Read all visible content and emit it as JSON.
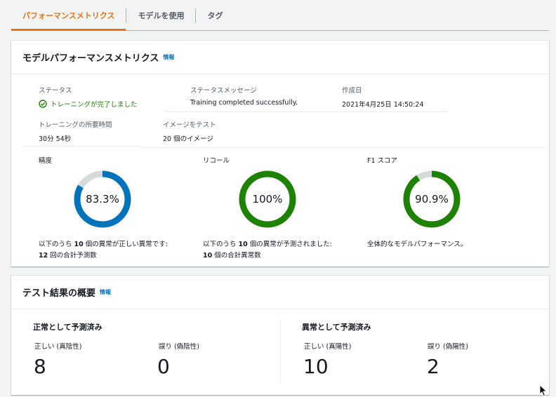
{
  "tabs": [
    {
      "label": "パフォーマンスメトリクス",
      "active": true
    },
    {
      "label": "モデルを使用",
      "active": false
    },
    {
      "label": "タグ",
      "active": false
    }
  ],
  "metrics_panel": {
    "title": "モデルパフォーマンスメトリクス",
    "info": "情報",
    "status": {
      "label": "ステータス",
      "value": "トレーニングが完了しました",
      "icon": "check-circle-icon"
    },
    "status_message": {
      "label": "ステータスメッセージ",
      "value": "Training completed successfully."
    },
    "created": {
      "label": "作成日",
      "value": "2021年4月25日 14:50:24"
    },
    "training_time": {
      "label": "トレーニングの所要時間",
      "value": "30分 54秒"
    },
    "test_images": {
      "label": "イメージをテスト",
      "value": "20 個のイメージ"
    },
    "precision": {
      "label": "精度",
      "value_text": "83.3%",
      "fraction": 0.833,
      "color": "#0073bb",
      "desc_1a": "以下のうち ",
      "desc_1b": "10",
      "desc_1c": " 個の異常が正しい異常です:",
      "desc_2a": "12",
      "desc_2b": " 回の合計予測数"
    },
    "recall": {
      "label": "リコール",
      "value_text": "100%",
      "fraction": 1.0,
      "color": "#1d8102",
      "desc_1a": "以下のうち ",
      "desc_1b": "10",
      "desc_1c": " 個の異常が予測されました:",
      "desc_2a": "10",
      "desc_2b": " 個の合計異常数"
    },
    "f1": {
      "label": "F1 スコア",
      "value_text": "90.9%",
      "fraction": 0.909,
      "color": "#1d8102",
      "desc": "全体的なモデルパフォーマンス。"
    }
  },
  "summary_panel": {
    "title": "テスト結果の概要",
    "info": "情報",
    "normal": {
      "heading": "正常として予測済み",
      "correct_label": "正しい (真陰性)",
      "correct_value": "8",
      "wrong_label": "誤り (偽陰性)",
      "wrong_value": "0"
    },
    "anomaly": {
      "heading": "異常として予測済み",
      "correct_label": "正しい (真陽性)",
      "correct_value": "10",
      "wrong_label": "誤り (偽陽性)",
      "wrong_value": "2"
    }
  },
  "colors": {
    "accent": "#ec7211",
    "link": "#0073bb",
    "success": "#1d8102",
    "track": "#d5dbdb"
  }
}
